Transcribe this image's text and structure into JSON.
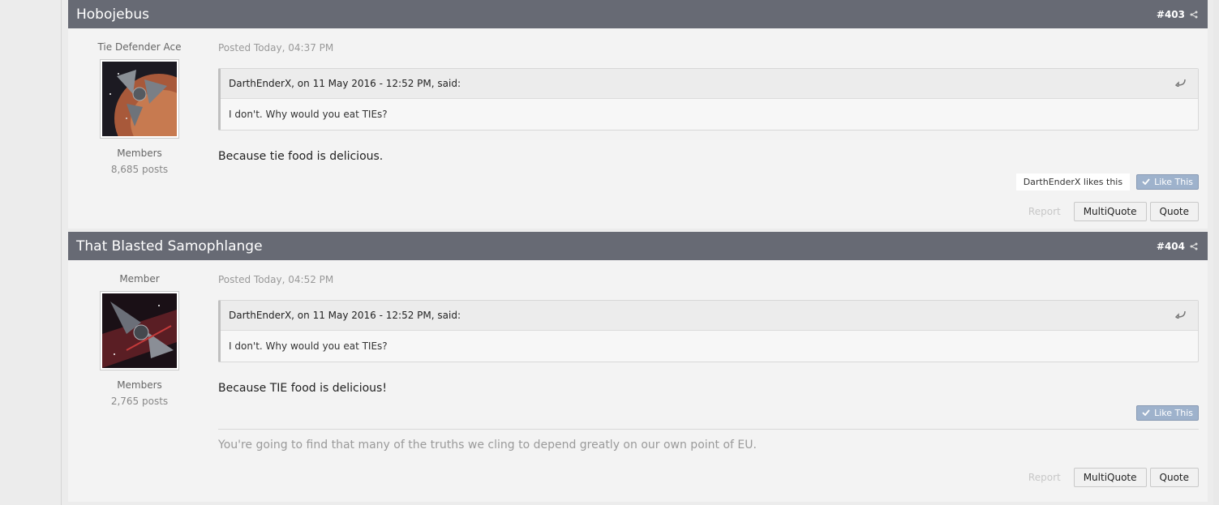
{
  "posts": [
    {
      "author": "Hobojebus",
      "number": "#403",
      "rank": "Tie Defender Ace",
      "group": "Members",
      "post_count": "8,685 posts",
      "posted": "Posted Today, 04:37 PM",
      "quote_cite": "DarthEnderX, on 11 May 2016 - 12:52 PM, said:",
      "quote_text": "I don't.  Why would you eat TIEs?",
      "message": "Because tie food is delicious.",
      "likes_text": "DarthEnderX likes this",
      "like_label": "Like This",
      "report_label": "Report",
      "multiquote_label": "MultiQuote",
      "quote_label": "Quote"
    },
    {
      "author": "That Blasted Samophlange",
      "number": "#404",
      "rank": "Member",
      "group": "Members",
      "post_count": "2,765 posts",
      "posted": "Posted Today, 04:52 PM",
      "quote_cite": "DarthEnderX, on 11 May 2016 - 12:52 PM, said:",
      "quote_text": "I don't.  Why would you eat TIEs?",
      "message": "Because TIE food is delicious!",
      "like_label": "Like This",
      "signature": "You're going to find that many of the truths we cling to depend greatly on our own point of EU.",
      "report_label": "Report",
      "multiquote_label": "MultiQuote",
      "quote_label": "Quote"
    }
  ],
  "icons": {
    "share": "share-icon",
    "quote_return": "return-arrow-icon",
    "like_check": "checkmark-icon"
  },
  "colors": {
    "header_bg": "#676a74",
    "like_button": "#9eb2cc"
  }
}
